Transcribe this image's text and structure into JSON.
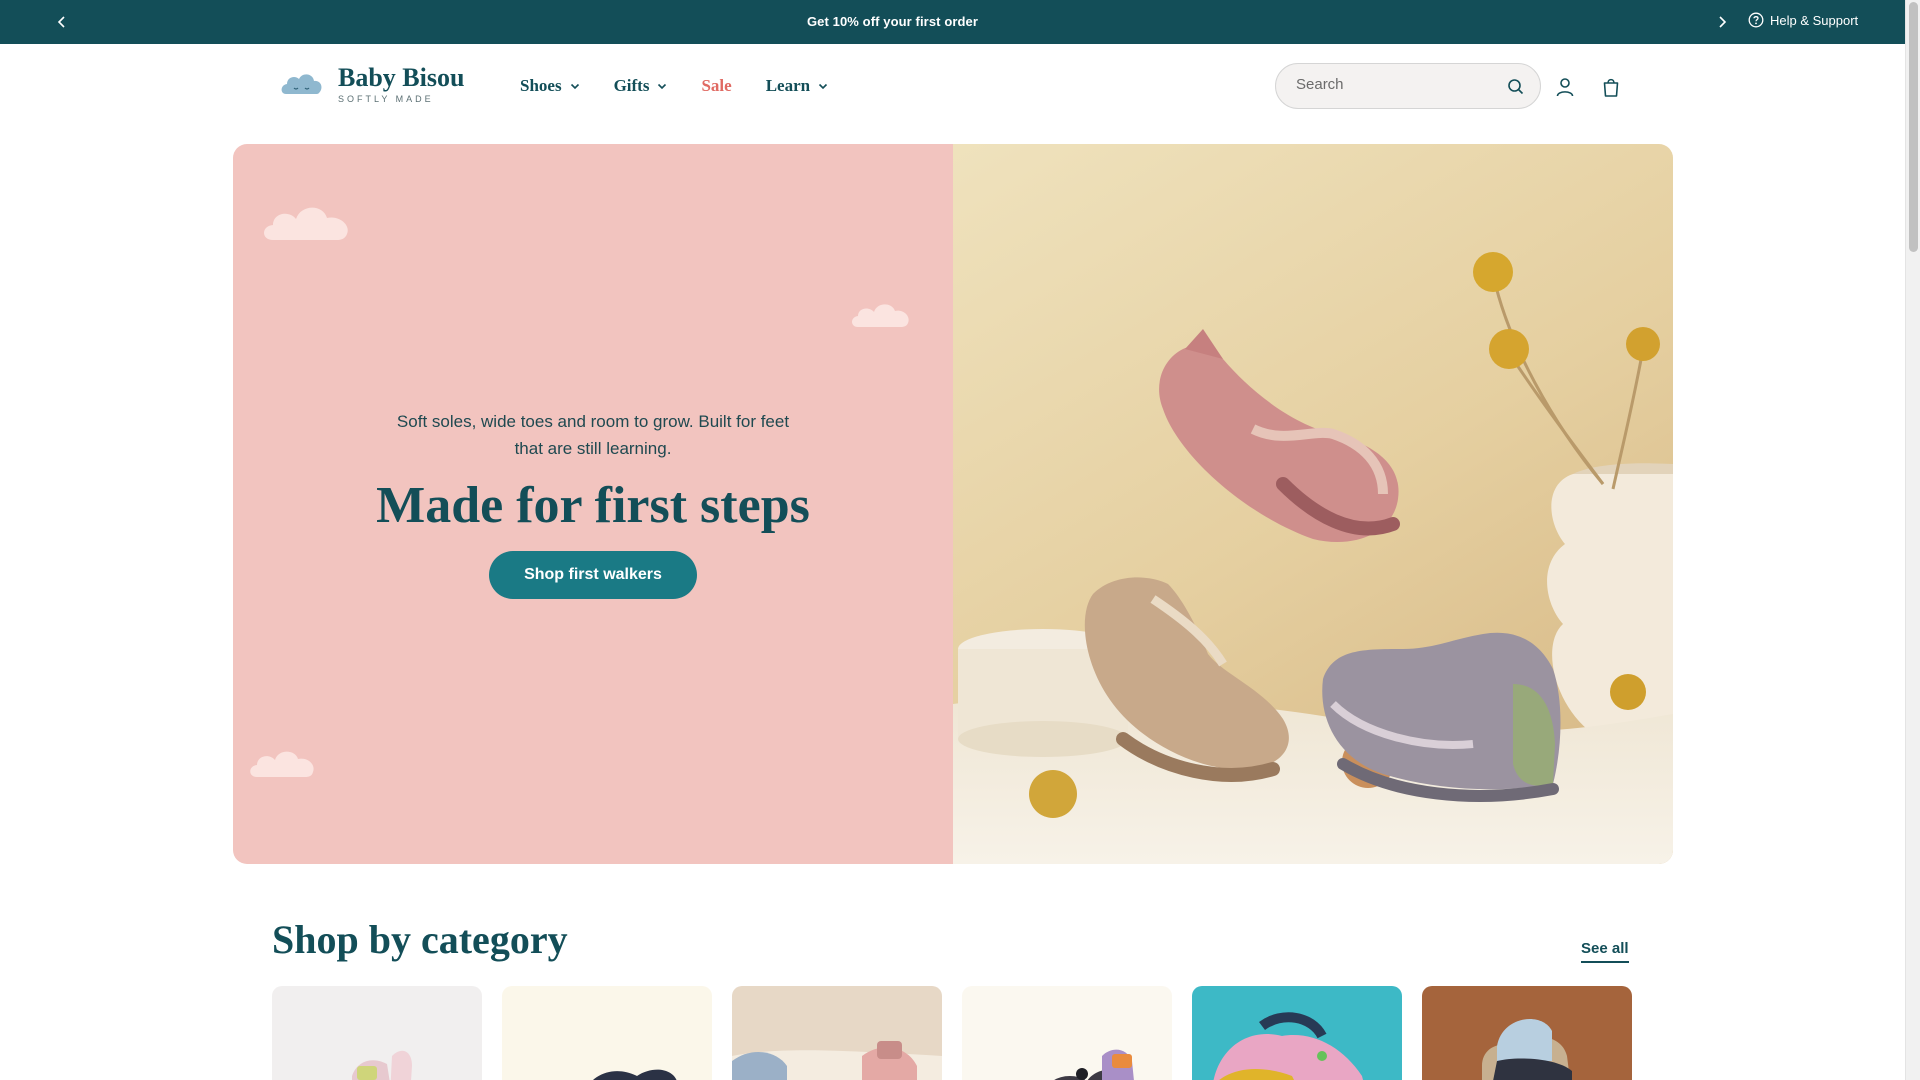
{
  "announcement": {
    "message": "Get 10% off your first order",
    "help_label": "Help & Support"
  },
  "header": {
    "brand_name": "Baby Bisou",
    "brand_tagline": "SOFTLY MADE",
    "nav": [
      {
        "label": "Shoes",
        "has_dropdown": true
      },
      {
        "label": "Gifts",
        "has_dropdown": true
      },
      {
        "label": "Sale",
        "has_dropdown": false
      },
      {
        "label": "Learn",
        "has_dropdown": true
      }
    ],
    "search_placeholder": "Search"
  },
  "hero": {
    "subtitle": "Soft soles, wide toes and room to grow. Built for feet that are still learning.",
    "title": "Made for first steps",
    "cta_label": "Shop first walkers"
  },
  "categories": {
    "title": "Shop by category",
    "see_all_label": "See all"
  },
  "colors": {
    "brand_dark": "#134e58",
    "accent_teal": "#1a7a85",
    "sale_red": "#e06a63",
    "hero_pink": "#f2c4bf"
  }
}
